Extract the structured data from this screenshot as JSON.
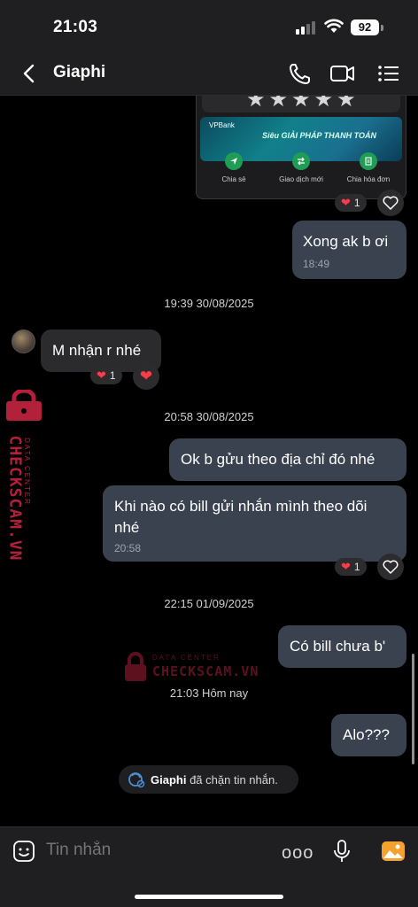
{
  "status_bar": {
    "time": "21:03",
    "battery": "92"
  },
  "header": {
    "contact_name": "Giaphi"
  },
  "shared_card": {
    "rating": "★★★★★",
    "bank": "VPBank",
    "banner_text": "Siêu GIẢI PHÁP THANH TOÁN",
    "actions": [
      "Chia sẻ",
      "Giao dịch mới",
      "Chia hóa đơn"
    ],
    "reaction_count": "1"
  },
  "messages": [
    {
      "text": "Xong ak b ơi",
      "time": "18:49",
      "sender": "me"
    },
    {
      "divider": "19:39 30/08/2025"
    },
    {
      "text": "M nhận r nhé",
      "sender": "them",
      "reaction_count": "1"
    },
    {
      "divider": "20:58 30/08/2025"
    },
    {
      "text": "Ok b gửu theo địa chỉ đó nhé",
      "sender": "me"
    },
    {
      "text": "Khi nào có bill gửi nhắn mình theo dõi nhé",
      "time": "20:58",
      "sender": "me",
      "reaction_count": "1"
    },
    {
      "divider": "22:15 01/09/2025"
    },
    {
      "text": "Có bill chưa b'",
      "sender": "me"
    },
    {
      "divider": "21:03 Hôm nay"
    },
    {
      "text": "Alo???",
      "sender": "me"
    }
  ],
  "system_notice": {
    "name": "Giaphi",
    "text": "đã chặn tin nhắn."
  },
  "watermark": {
    "brand": "CHECKSCAM.VN",
    "sub": "DATA CENTER"
  },
  "input": {
    "placeholder": "Tin nhắn",
    "more": "ooo"
  },
  "colors": {
    "my_bubble": "#3a4250",
    "their_bubble": "#2b2b2d",
    "heart": "#ff3b4a",
    "watermark": "#b3203a",
    "accent_green": "#1f9d55"
  }
}
